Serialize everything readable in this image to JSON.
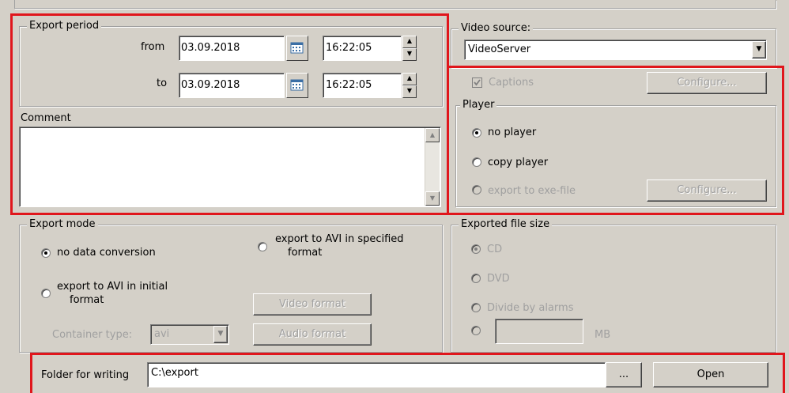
{
  "export_period": {
    "legend": "Export period",
    "from_label": "from",
    "from_date": "03.09.2018",
    "from_time": "16:22:05",
    "to_label": "to",
    "to_date": "03.09.2018",
    "to_time": "16:22:05"
  },
  "comment": {
    "label": "Comment",
    "value": ""
  },
  "video_source": {
    "legend": "Video source:",
    "selected": "VideoServer"
  },
  "captions": {
    "label": "Captions",
    "checked": true,
    "configure_label": "Configure..."
  },
  "player": {
    "legend": "Player",
    "options": [
      {
        "label": "no player",
        "checked": true,
        "enabled": true
      },
      {
        "label": "copy player",
        "checked": false,
        "enabled": true
      },
      {
        "label": "export to exe-file",
        "checked": false,
        "enabled": false
      }
    ],
    "configure_label": "Configure..."
  },
  "export_mode": {
    "legend": "Export mode",
    "no_conversion": "no data conversion",
    "avi_initial_1": "export to AVI in initial",
    "avi_initial_2": "format",
    "avi_specified_1": "export to AVI in specified",
    "avi_specified_2": "format",
    "container_label": "Container type:",
    "container_value": "avi",
    "video_format": "Video format",
    "audio_format": "Audio format"
  },
  "file_size": {
    "legend": "Exported file size",
    "cd": "CD",
    "dvd": "DVD",
    "divide": "Divide by alarms",
    "custom_value": "",
    "unit": "MB"
  },
  "folder": {
    "label": "Folder for writing",
    "path": "C:\\export",
    "browse_label": "...",
    "open_label": "Open"
  },
  "colors": {
    "highlight": "#e0161c",
    "background": "#d4d0c8"
  }
}
